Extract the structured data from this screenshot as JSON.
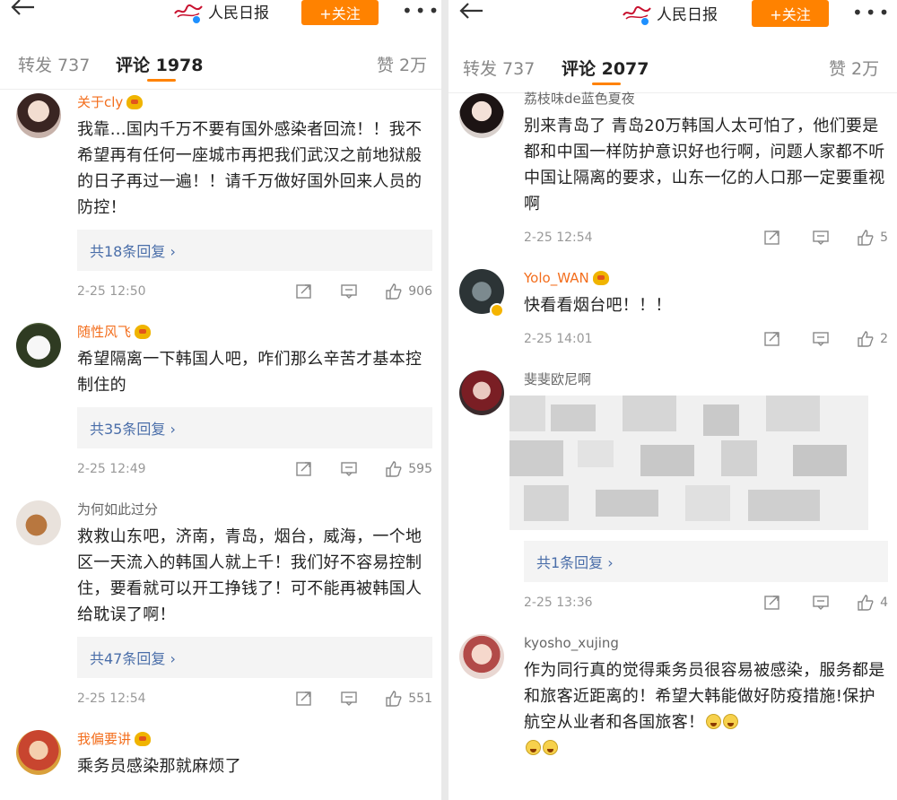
{
  "left": {
    "header": {
      "account_name": "人民日报",
      "follow_label": "+关注",
      "more_label": "•••"
    },
    "tabs": {
      "repost": "转发 737",
      "comments": "评论 1978",
      "likes": "赞 2万"
    },
    "comments": [
      {
        "username": "关于cly",
        "username_style": "vip",
        "text": "我靠…国内千万不要有国外感染者回流！！我不希望再有任何一座城市再把我们武汉之前地狱般的日子再过一遍！！请千万做好国外回来人员的防控！",
        "replies": "共18条回复 ›",
        "time": "2-25 12:50",
        "likes": "906"
      },
      {
        "username": "随性风飞",
        "username_style": "vip",
        "text": "希望隔离一下韩国人吧，咋们那么辛苦才基本控制住的",
        "replies": "共35条回复 ›",
        "time": "2-25 12:49",
        "likes": "595"
      },
      {
        "username": "为何如此过分",
        "username_style": "normal",
        "text": "救救山东吧，济南，青岛，烟台，威海，一个地区一天流入的韩国人就上千！我们好不容易控制住，要看就可以开工挣钱了！可不能再被韩国人给耽误了啊！",
        "replies": "共47条回复 ›",
        "time": "2-25 12:54",
        "likes": "551"
      },
      {
        "username": "我偏要讲",
        "username_style": "vip",
        "text": "乘务员感染那就麻烦了"
      }
    ]
  },
  "right": {
    "header": {
      "account_name": "人民日报",
      "follow_label": "+关注",
      "more_label": "•••"
    },
    "tabs": {
      "repost": "转发 737",
      "comments": "评论 2077",
      "likes": "赞 2万"
    },
    "comments": [
      {
        "username": "荔枝味de蓝色夏夜",
        "username_style": "normal",
        "text": "别来青岛了 青岛20万韩国人太可怕了，他们要是都和中国一样防护意识好也行啊，问题人家都不听中国让隔离的要求，山东一亿的人口那一定要重视啊",
        "time": "2-25 12:54",
        "likes": "5"
      },
      {
        "username": "Yolo_WAN",
        "username_style": "vip",
        "text": "快看看烟台吧！！！",
        "time": "2-25 14:01",
        "likes": "2"
      },
      {
        "username": "斐斐欧尼啊",
        "username_style": "normal",
        "replies": "共1条回复 ›",
        "time": "2-25 13:36",
        "likes": "4"
      },
      {
        "username": "kyosho_xujing",
        "username_style": "normal",
        "text": "作为同行真的觉得乘务员很容易被感染，服务都是和旅客近距离的！希望大韩能做好防疫措施!保护航空从业者和各国旅客！"
      }
    ]
  },
  "colors": {
    "accent": "#ff8200",
    "vip_name": "#f36e1d",
    "link": "#4a6ea9"
  },
  "icons": [
    "back-arrow-icon",
    "verified-icon",
    "more-icon",
    "repost-icon",
    "comment-icon",
    "like-icon",
    "vip-badge-icon",
    "emoji-icon"
  ]
}
